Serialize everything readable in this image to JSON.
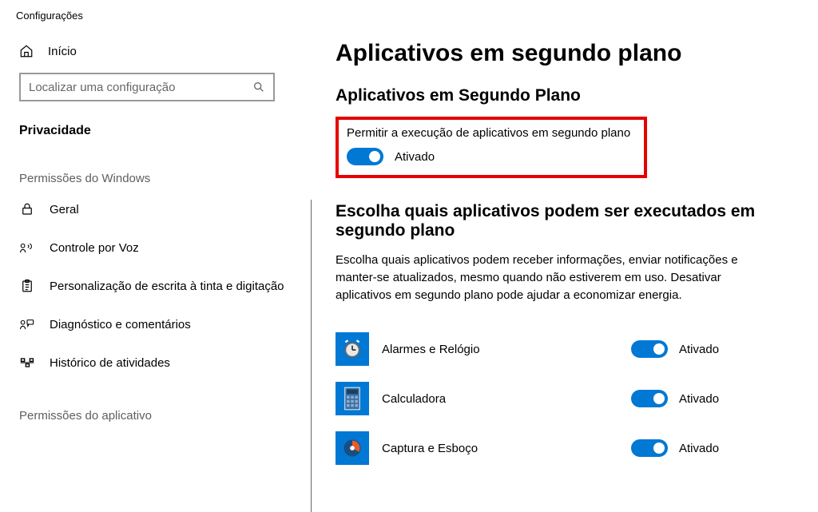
{
  "window": {
    "title": "Configurações"
  },
  "sidebar": {
    "home": "Início",
    "search_placeholder": "Localizar uma configuração",
    "category": "Privacidade",
    "section1": "Permissões do Windows",
    "items": [
      {
        "label": "Geral"
      },
      {
        "label": "Controle por Voz"
      },
      {
        "label": "Personalização de escrita à tinta e digitação"
      },
      {
        "label": "Diagnóstico e comentários"
      },
      {
        "label": "Histórico de atividades"
      }
    ],
    "section2": "Permissões do aplicativo"
  },
  "main": {
    "h1": "Aplicativos em segundo plano",
    "h2a": "Aplicativos em Segundo Plano",
    "master_label": "Permitir a execução de aplicativos em segundo plano",
    "master_state": "Ativado",
    "h2b": "Escolha quais aplicativos podem ser executados em segundo plano",
    "desc": "Escolha quais aplicativos podem receber informações, enviar notificações e manter-se atualizados, mesmo quando não estiverem em uso. Desativar aplicativos em segundo plano pode ajudar a economizar energia.",
    "apps": [
      {
        "name": "Alarmes e Relógio",
        "state": "Ativado"
      },
      {
        "name": "Calculadora",
        "state": "Ativado"
      },
      {
        "name": "Captura e Esboço",
        "state": "Ativado"
      }
    ]
  }
}
